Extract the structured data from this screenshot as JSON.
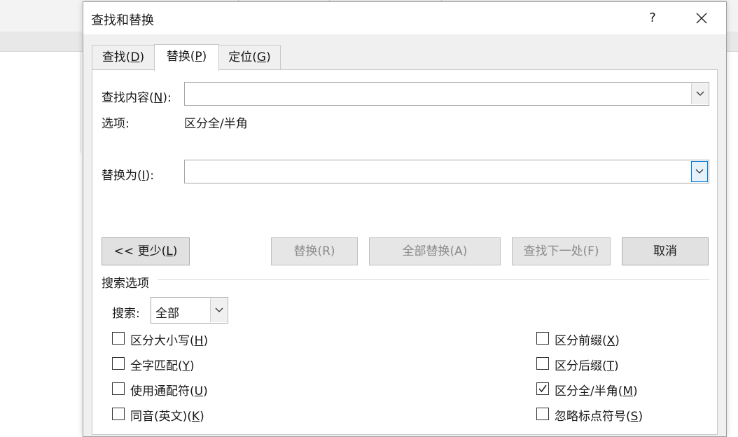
{
  "dialog": {
    "title": "查找和替换",
    "help": "?"
  },
  "tabs": [
    {
      "label": "查找(",
      "key": "D",
      "end": ")"
    },
    {
      "label": "替换(",
      "key": "P",
      "end": ")"
    },
    {
      "label": "定位(",
      "key": "G",
      "end": ")"
    }
  ],
  "find": {
    "label": "查找内容(",
    "key": "N",
    "end": "):",
    "value": ""
  },
  "options": {
    "label": "选项:",
    "value": "区分全/半角"
  },
  "replace": {
    "label": "替换为(",
    "key": "I",
    "end": "):",
    "value": ""
  },
  "buttons": {
    "less": {
      "label": "<< 更少(",
      "key": "L",
      "end": ")"
    },
    "replace": "替换(R)",
    "replace_all": "全部替换(A)",
    "find_next": "查找下一处(F)",
    "cancel": "取消"
  },
  "search_options": {
    "heading": "搜索选项",
    "search_label": "搜索:",
    "search_value": "全部"
  },
  "checkboxes_left": [
    {
      "label": "区分大小写(",
      "key": "H",
      "end": ")",
      "checked": false
    },
    {
      "label": "全字匹配(",
      "key": "Y",
      "end": ")",
      "checked": false
    },
    {
      "label": "使用通配符(",
      "key": "U",
      "end": ")",
      "checked": false
    },
    {
      "label": "同音(英文)(",
      "key": "K",
      "end": ")",
      "checked": false
    }
  ],
  "checkboxes_right": [
    {
      "label": "区分前缀(",
      "key": "X",
      "end": ")",
      "checked": false
    },
    {
      "label": "区分后缀(",
      "key": "T",
      "end": ")",
      "checked": false
    },
    {
      "label": "区分全/半角(",
      "key": "M",
      "end": ")",
      "checked": true
    },
    {
      "label": "忽略标点符号(",
      "key": "S",
      "end": ")",
      "checked": false
    }
  ]
}
